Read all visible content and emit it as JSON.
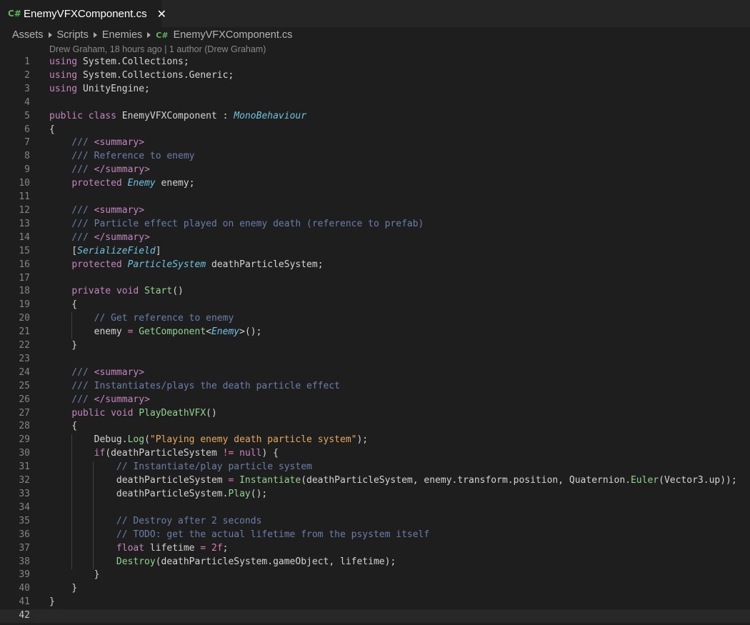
{
  "tab": {
    "icon": "C#",
    "title": "EnemyVFXComponent.cs",
    "close": "✕"
  },
  "breadcrumb": [
    "Assets",
    "Scripts",
    "Enemies",
    "EnemyVFXComponent.cs"
  ],
  "breadcrumb_icon": "C#",
  "blame": "Drew Graham, 18 hours ago | 1 author (Drew Graham)",
  "current_line": 42,
  "lines": [
    [
      [
        "k",
        "using"
      ],
      [
        "n",
        " System.Collections;"
      ]
    ],
    [
      [
        "k",
        "using"
      ],
      [
        "n",
        " System.Collections.Generic;"
      ]
    ],
    [
      [
        "k",
        "using"
      ],
      [
        "n",
        " UnityEngine;"
      ]
    ],
    [],
    [
      [
        "k",
        "public"
      ],
      [
        "n",
        " "
      ],
      [
        "k",
        "class"
      ],
      [
        "n",
        " EnemyVFXComponent : "
      ],
      [
        "t",
        "MonoBehaviour"
      ]
    ],
    [
      [
        "n",
        "{"
      ]
    ],
    [
      [
        "c",
        "    /// "
      ],
      [
        "k",
        "<"
      ],
      [
        "k",
        "summary"
      ],
      [
        "k",
        ">"
      ]
    ],
    [
      [
        "c",
        "    /// Reference to enemy"
      ]
    ],
    [
      [
        "c",
        "    /// "
      ],
      [
        "k",
        "</"
      ],
      [
        "k",
        "summary"
      ],
      [
        "k",
        ">"
      ]
    ],
    [
      [
        "n",
        "    "
      ],
      [
        "k",
        "protected"
      ],
      [
        "n",
        " "
      ],
      [
        "t",
        "Enemy"
      ],
      [
        "n",
        " enemy;"
      ]
    ],
    [],
    [
      [
        "c",
        "    /// "
      ],
      [
        "k",
        "<"
      ],
      [
        "k",
        "summary"
      ],
      [
        "k",
        ">"
      ]
    ],
    [
      [
        "c",
        "    /// Particle effect played on enemy death (reference to prefab)"
      ]
    ],
    [
      [
        "c",
        "    /// "
      ],
      [
        "k",
        "</"
      ],
      [
        "k",
        "summary"
      ],
      [
        "k",
        ">"
      ]
    ],
    [
      [
        "n",
        "    ["
      ],
      [
        "t",
        "SerializeField"
      ],
      [
        "n",
        "]"
      ]
    ],
    [
      [
        "n",
        "    "
      ],
      [
        "k",
        "protected"
      ],
      [
        "n",
        " "
      ],
      [
        "t",
        "ParticleSystem"
      ],
      [
        "n",
        " deathParticleSystem;"
      ]
    ],
    [],
    [
      [
        "n",
        "    "
      ],
      [
        "k",
        "private"
      ],
      [
        "n",
        " "
      ],
      [
        "k",
        "void"
      ],
      [
        "n",
        " "
      ],
      [
        "f",
        "Start"
      ],
      [
        "n",
        "()"
      ]
    ],
    [
      [
        "n",
        "    {"
      ]
    ],
    [
      [
        "c",
        "        // Get reference to enemy"
      ]
    ],
    [
      [
        "n",
        "        enemy "
      ],
      [
        "o",
        "="
      ],
      [
        "n",
        " "
      ],
      [
        "f",
        "GetComponent"
      ],
      [
        "n",
        "<"
      ],
      [
        "t",
        "Enemy"
      ],
      [
        "n",
        ">();"
      ]
    ],
    [
      [
        "n",
        "    }"
      ]
    ],
    [],
    [
      [
        "c",
        "    /// "
      ],
      [
        "k",
        "<"
      ],
      [
        "k",
        "summary"
      ],
      [
        "k",
        ">"
      ]
    ],
    [
      [
        "c",
        "    /// Instantiates/plays the death particle effect"
      ]
    ],
    [
      [
        "c",
        "    /// "
      ],
      [
        "k",
        "</"
      ],
      [
        "k",
        "summary"
      ],
      [
        "k",
        ">"
      ]
    ],
    [
      [
        "n",
        "    "
      ],
      [
        "k",
        "public"
      ],
      [
        "n",
        " "
      ],
      [
        "k",
        "void"
      ],
      [
        "n",
        " "
      ],
      [
        "f",
        "PlayDeathVFX"
      ],
      [
        "n",
        "()"
      ]
    ],
    [
      [
        "n",
        "    {"
      ]
    ],
    [
      [
        "n",
        "        Debug."
      ],
      [
        "f",
        "Log"
      ],
      [
        "n",
        "("
      ],
      [
        "s",
        "\"Playing enemy death particle system\""
      ],
      [
        "n",
        ");"
      ]
    ],
    [
      [
        "n",
        "        "
      ],
      [
        "k",
        "if"
      ],
      [
        "n",
        "(deathParticleSystem "
      ],
      [
        "o",
        "!="
      ],
      [
        "n",
        " "
      ],
      [
        "k",
        "null"
      ],
      [
        "n",
        ") {"
      ]
    ],
    [
      [
        "c",
        "            // Instantiate/play particle system"
      ]
    ],
    [
      [
        "n",
        "            deathParticleSystem "
      ],
      [
        "o",
        "="
      ],
      [
        "n",
        " "
      ],
      [
        "f",
        "Instantiate"
      ],
      [
        "n",
        "(deathParticleSystem, enemy.transform.position, Quaternion."
      ],
      [
        "f",
        "Euler"
      ],
      [
        "n",
        "(Vector3.up));"
      ]
    ],
    [
      [
        "n",
        "            deathParticleSystem."
      ],
      [
        "f",
        "Play"
      ],
      [
        "n",
        "();"
      ]
    ],
    [],
    [
      [
        "c",
        "            // Destroy after 2 seconds"
      ]
    ],
    [
      [
        "c",
        "            // TODO: get the actual lifetime from the psystem itself"
      ]
    ],
    [
      [
        "n",
        "            "
      ],
      [
        "k",
        "float"
      ],
      [
        "n",
        " lifetime "
      ],
      [
        "o",
        "="
      ],
      [
        "n",
        " "
      ],
      [
        "o",
        "2f"
      ],
      [
        "n",
        ";"
      ]
    ],
    [
      [
        "n",
        "            "
      ],
      [
        "f",
        "Destroy"
      ],
      [
        "n",
        "(deathParticleSystem.gameObject, lifetime);"
      ]
    ],
    [
      [
        "n",
        "        }"
      ]
    ],
    [
      [
        "n",
        "    }"
      ]
    ],
    [
      [
        "n",
        "}"
      ]
    ],
    []
  ]
}
